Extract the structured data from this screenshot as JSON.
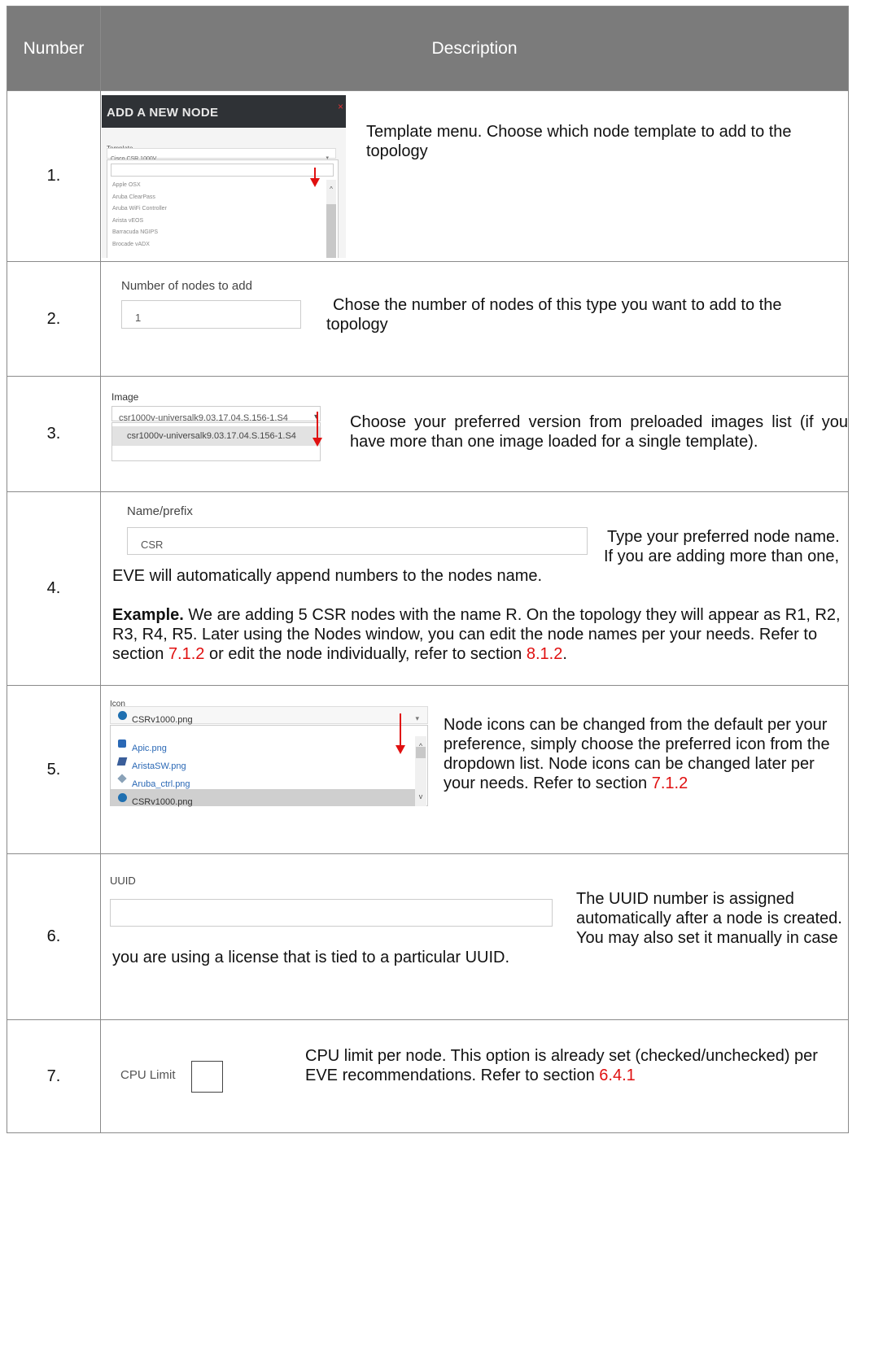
{
  "header": {
    "number": "Number",
    "description": "Description"
  },
  "rows": [
    {
      "number": "1.",
      "dialog_title": "ADD A NEW NODE",
      "close": "×",
      "field_label": "Template",
      "selected": "Cisco CSR 1000V",
      "options": [
        "Apple OSX",
        "Aruba ClearPass",
        "Aruba WiFi Controller",
        "Arista vEOS",
        "Barracuda NGIPS",
        "Brocade vADX"
      ],
      "text": "Template menu. Choose which node template to add to the topology"
    },
    {
      "number": "2.",
      "field_label": "Number of nodes to add",
      "value": "1",
      "text": "Chose the number of nodes of this type you want to add to the topology"
    },
    {
      "number": "3.",
      "field_label": "Image",
      "selected": "csr1000v-universalk9.03.17.04.S.156-1.S4",
      "option": "csr1000v-universalk9.03.17.04.S.156-1.S4",
      "text": "Choose your preferred version from preloaded images list (if you have more than one image loaded for a single template)."
    },
    {
      "number": "4.",
      "field_label": "Name/prefix",
      "value": "CSR",
      "text_a": "Type your preferred node name. If you are adding more than one, EVE will automatically append numbers to the nodes name.",
      "example_bold": "Example.",
      "example_text": "We are adding 5 CSR nodes with the name R. On the topology they will appear as R1, R2, R3, R4, R5. Later using the Nodes window, you can edit the node names per your needs. Refer to section",
      "ref1": "7.1.2",
      "mid_text": "or edit the node individually, refer to section",
      "ref2": "8.1.2",
      "end": "."
    },
    {
      "number": "5.",
      "field_label": "Icon",
      "selected": "CSRv1000.png",
      "options": [
        "Apic.png",
        "AristaSW.png",
        "Aruba_ctrl.png",
        "CSRv1000.png"
      ],
      "text": "Node icons can be changed from the default per your preference, simply choose the preferred icon from the dropdown list. Node icons can be changed later per your needs. Refer to section",
      "ref": "7.1.2"
    },
    {
      "number": "6.",
      "field_label": "UUID",
      "value": "",
      "text": "The UUID number is assigned automatically after a node is created. You may also set it manually in case you are using a license that is tied to a particular UUID."
    },
    {
      "number": "7.",
      "field_label": "CPU Limit",
      "text": "CPU limit per node. This option is already set (checked/unchecked) per EVE recommendations. Refer to section",
      "ref": "6.4.1"
    }
  ],
  "colors": {
    "header_bg": "#7b7b7b",
    "link": "#e01010",
    "dialog_bg": "#2f3236"
  }
}
